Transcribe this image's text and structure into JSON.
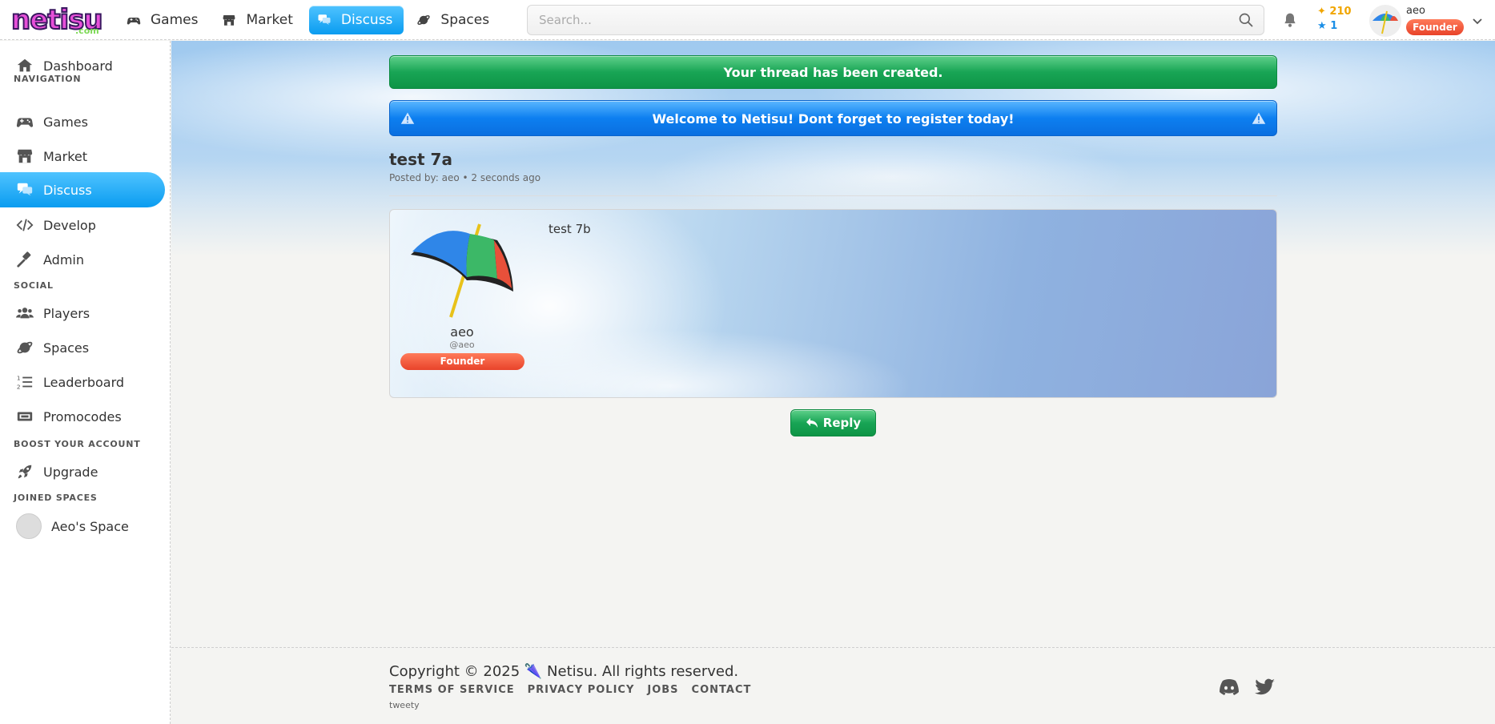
{
  "app": {
    "logo_text": "netisu",
    "logo_sub": ".com"
  },
  "topnav": [
    {
      "label": "Games",
      "icon": "gamepad-icon"
    },
    {
      "label": "Market",
      "icon": "store-icon"
    },
    {
      "label": "Discuss",
      "icon": "chat-icon",
      "active": true
    },
    {
      "label": "Spaces",
      "icon": "planet-icon"
    }
  ],
  "search": {
    "placeholder": "Search..."
  },
  "currency": {
    "coins": "210",
    "stars": "1"
  },
  "user": {
    "name": "aeo",
    "badge": "Founder"
  },
  "sidebar": {
    "dashboard": "Dashboard",
    "nav_heading": "NAVIGATION",
    "games": "Games",
    "market": "Market",
    "discuss": "Discuss",
    "develop": "Develop",
    "admin": "Admin",
    "social_heading": "SOCIAL",
    "players": "Players",
    "spaces": "Spaces",
    "leaderboard": "Leaderboard",
    "promocodes": "Promocodes",
    "boost_heading": "BOOST YOUR ACCOUNT",
    "upgrade": "Upgrade",
    "joined_heading": "JOINED SPACES",
    "space_name": "Aeo's Space"
  },
  "alerts": {
    "success": "Your thread has been created.",
    "info": "Welcome to Netisu! Dont forget to register today!"
  },
  "thread": {
    "title": "test 7a",
    "meta": "Posted by: aeo • 2 seconds ago"
  },
  "post": {
    "author": "aeo",
    "handle": "@aeo",
    "badge": "Founder",
    "body": "test 7b"
  },
  "reply_label": "Reply",
  "footer": {
    "copyright": "Copyright © 2025 🌂 Netisu. All rights reserved.",
    "links": [
      "TERMS OF SERVICE",
      "PRIVACY POLICY",
      "JOBS",
      "CONTACT"
    ],
    "sub": "tweety"
  },
  "colors": {
    "accent_blue": "#0a9cf0",
    "success_green": "#18a555",
    "founder_red": "#e8432a"
  }
}
